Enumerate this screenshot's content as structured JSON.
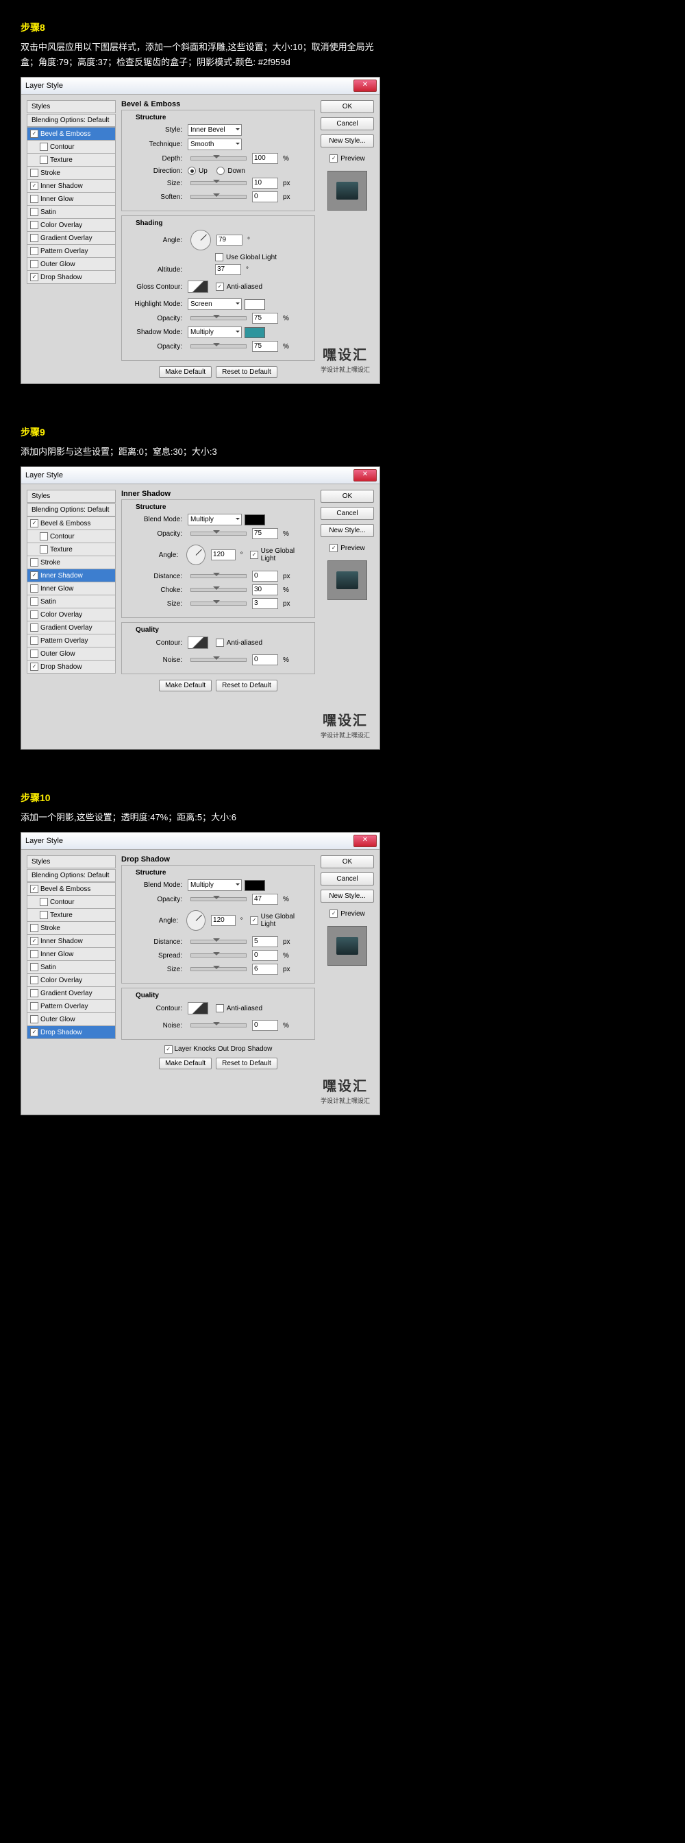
{
  "watermark": {
    "title": "嘿设汇",
    "sub": "学设计就上嘿设汇"
  },
  "dialog_title": "Layer Style",
  "sidebar": {
    "head1": "Styles",
    "head2": "Blending Options: Default",
    "items": [
      "Bevel & Emboss",
      "Contour",
      "Texture",
      "Stroke",
      "Inner Shadow",
      "Inner Glow",
      "Satin",
      "Color Overlay",
      "Gradient Overlay",
      "Pattern Overlay",
      "Outer Glow",
      "Drop Shadow"
    ]
  },
  "buttons": {
    "ok": "OK",
    "cancel": "Cancel",
    "newstyle": "New Style...",
    "preview": "Preview",
    "make_default": "Make Default",
    "reset_default": "Reset to Default"
  },
  "step8": {
    "title": "步骤8",
    "desc": "双击中风层应用以下图层样式，添加一个斜面和浮雕,这些设置；大小:10；取消使用全局光盒；角度:79；高度:37；检查反锯齿的盒子；阴影模式-颜色: #2f959d",
    "panel": "Bevel & Emboss",
    "sect1": "Structure",
    "sect2": "Shading",
    "labels": {
      "style": "Style:",
      "technique": "Technique:",
      "depth": "Depth:",
      "direction": "Direction:",
      "up": "Up",
      "down": "Down",
      "size": "Size:",
      "soften": "Soften:",
      "angle": "Angle:",
      "altitude": "Altitude:",
      "ugl": "Use Global Light",
      "gloss": "Gloss Contour:",
      "aa": "Anti-aliased",
      "hmode": "Highlight Mode:",
      "opacity": "Opacity:",
      "smode": "Shadow Mode:"
    },
    "values": {
      "style": "Inner Bevel",
      "technique": "Smooth",
      "depth": "100",
      "size": "10",
      "soften": "0",
      "angle": "79",
      "altitude": "37",
      "hmode": "Screen",
      "hopacity": "75",
      "smode": "Multiply",
      "sopacity": "75",
      "scolor": "#2f959d",
      "deg": "°",
      "pct": "%",
      "px": "px"
    }
  },
  "step9": {
    "title": "步骤9",
    "desc": "添加内阴影与这些设置；距离:0；窒息:30；大小:3",
    "panel": "Inner Shadow",
    "sect1": "Structure",
    "sect2": "Quality",
    "labels": {
      "bmode": "Blend Mode:",
      "opacity": "Opacity:",
      "angle": "Angle:",
      "ugl": "Use Global Light",
      "distance": "Distance:",
      "choke": "Choke:",
      "size": "Size:",
      "contour": "Contour:",
      "aa": "Anti-aliased",
      "noise": "Noise:"
    },
    "values": {
      "bmode": "Multiply",
      "opacity": "75",
      "angle": "120",
      "distance": "0",
      "choke": "30",
      "size": "3",
      "noise": "0",
      "pct": "%",
      "px": "px",
      "deg": "°"
    }
  },
  "step10": {
    "title": "步骤10",
    "desc": "添加一个阴影,这些设置；透明度:47%；距离:5；大小:6",
    "panel": "Drop Shadow",
    "sect1": "Structure",
    "sect2": "Quality",
    "labels": {
      "bmode": "Blend Mode:",
      "opacity": "Opacity:",
      "angle": "Angle:",
      "ugl": "Use Global Light",
      "distance": "Distance:",
      "spread": "Spread:",
      "size": "Size:",
      "contour": "Contour:",
      "aa": "Anti-aliased",
      "noise": "Noise:",
      "knock": "Layer Knocks Out Drop Shadow"
    },
    "values": {
      "bmode": "Multiply",
      "opacity": "47",
      "angle": "120",
      "distance": "5",
      "spread": "0",
      "size": "6",
      "noise": "0",
      "pct": "%",
      "px": "px",
      "deg": "°"
    }
  }
}
